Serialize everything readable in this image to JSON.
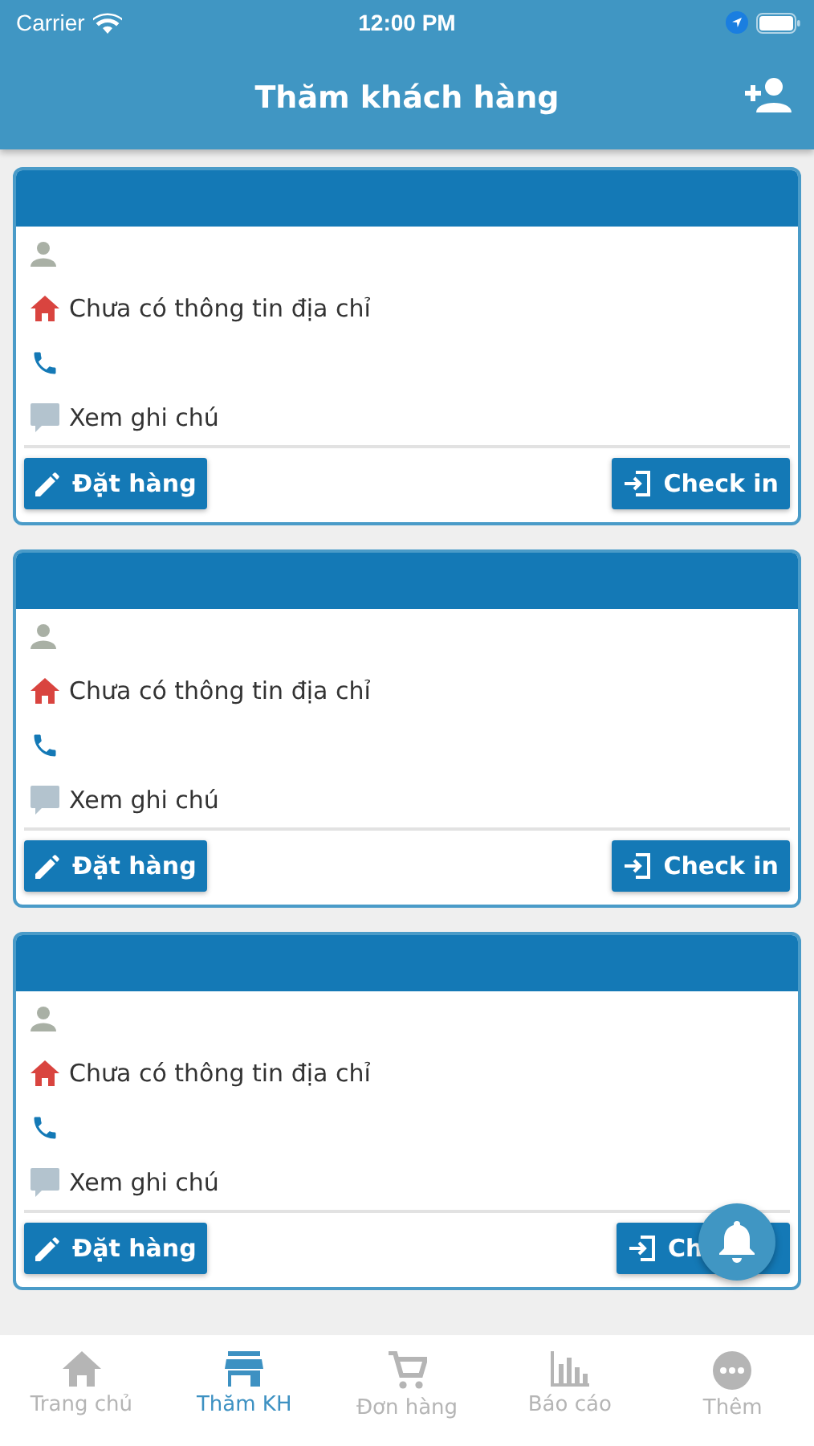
{
  "status_bar": {
    "carrier": "Carrier",
    "time": "12:00 PM"
  },
  "header": {
    "title": "Thăm khách hàng"
  },
  "cards": [
    {
      "address": "Chưa có thông tin địa chỉ",
      "note": "Xem ghi chú",
      "order_button": "Đặt hàng",
      "checkin_button": "Check in"
    },
    {
      "address": "Chưa có thông tin địa chỉ",
      "note": "Xem ghi chú",
      "order_button": "Đặt hàng",
      "checkin_button": "Check in"
    },
    {
      "address": "Chưa có thông tin địa chỉ",
      "note": "Xem ghi chú",
      "order_button": "Đặt hàng",
      "checkin_button": "Ch"
    }
  ],
  "tabs": [
    {
      "label": "Trang chủ",
      "kind": "home",
      "selected": false
    },
    {
      "label": "Thăm KH",
      "kind": "store",
      "selected": true
    },
    {
      "label": "Đơn hàng",
      "kind": "cart",
      "selected": false
    },
    {
      "label": "Báo cáo",
      "kind": "chart",
      "selected": false
    },
    {
      "label": "Thêm",
      "kind": "more",
      "selected": false
    }
  ]
}
